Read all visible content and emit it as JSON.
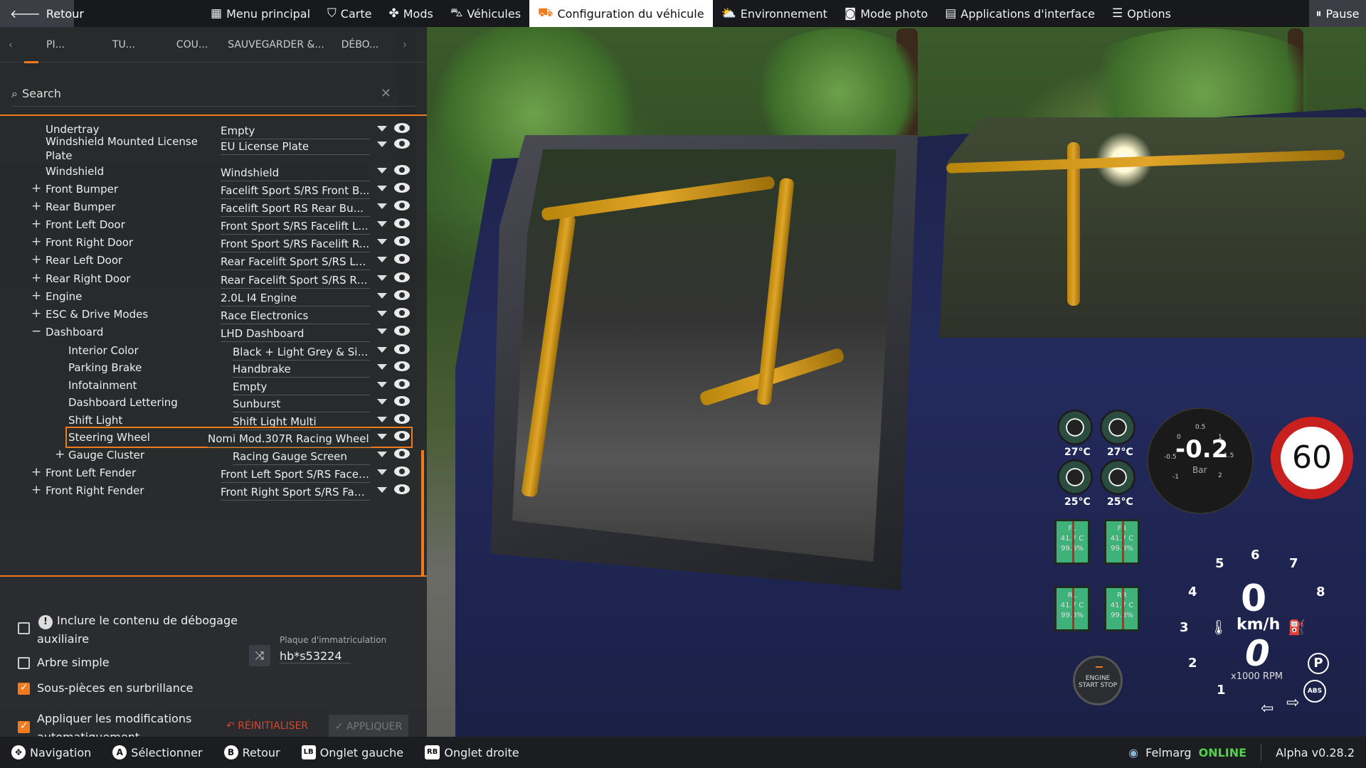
{
  "topbar": {
    "back_label": "Retour",
    "items": [
      {
        "label": "Menu principal",
        "icon": "grid-icon"
      },
      {
        "label": "Carte",
        "icon": "map-icon"
      },
      {
        "label": "Mods",
        "icon": "puzzle-icon"
      },
      {
        "label": "Véhicules",
        "icon": "car-icon"
      },
      {
        "label": "Configuration du véhicule",
        "icon": "car-config-icon",
        "active": true
      },
      {
        "label": "Environnement",
        "icon": "weather-icon"
      },
      {
        "label": "Mode photo",
        "icon": "camera-icon"
      },
      {
        "label": "Applications d'interface",
        "icon": "apps-icon"
      },
      {
        "label": "Options",
        "icon": "sliders-icon"
      }
    ],
    "pause_label": "Pause"
  },
  "tabs": [
    "PI...",
    "TU...",
    "COU...",
    "SAUVEGARDER &...",
    "DÉBO..."
  ],
  "search": {
    "placeholder": "Search"
  },
  "parts": [
    {
      "name": "Undertray",
      "value": "Empty",
      "expand": ""
    },
    {
      "name": "Windshield Mounted License Plate",
      "value": "EU License Plate",
      "expand": ""
    },
    {
      "name": "Windshield",
      "value": "Windshield",
      "expand": ""
    },
    {
      "name": "Front Bumper",
      "value": "Facelift Sport S/RS Front B...",
      "expand": "+"
    },
    {
      "name": "Rear Bumper",
      "value": "Facelift Sport RS Rear Bu...",
      "expand": "+"
    },
    {
      "name": "Front Left Door",
      "value": "Front Sport S/RS Facelift L...",
      "expand": "+"
    },
    {
      "name": "Front Right Door",
      "value": "Front Sport S/RS Facelift R...",
      "expand": "+"
    },
    {
      "name": "Rear Left Door",
      "value": "Rear Facelift Sport S/RS Le...",
      "expand": "+"
    },
    {
      "name": "Rear Right Door",
      "value": "Rear Facelift Sport S/RS Ri...",
      "expand": "+"
    },
    {
      "name": "Engine",
      "value": "2.0L I4 Engine",
      "expand": "+"
    },
    {
      "name": "ESC & Drive Modes",
      "value": "Race Electronics",
      "expand": "+"
    },
    {
      "name": "Dashboard",
      "value": "LHD Dashboard",
      "expand": "−"
    },
    {
      "name": "Interior Color",
      "value": "Black + Light Grey & Silver",
      "expand": ""
    },
    {
      "name": "Parking Brake",
      "value": "Handbrake",
      "expand": ""
    },
    {
      "name": "Infotainment",
      "value": "Empty",
      "expand": ""
    },
    {
      "name": "Dashboard Lettering",
      "value": "Sunburst",
      "expand": ""
    },
    {
      "name": "Shift Light",
      "value": "Shift Light Multi",
      "expand": ""
    },
    {
      "name": "Steering Wheel",
      "value": "Nomi Mod.307R Racing Wheel",
      "expand": "",
      "highlighted": true
    },
    {
      "name": "Gauge Cluster",
      "value": "Racing Gauge Screen",
      "expand": "+"
    },
    {
      "name": "Front Left Fender",
      "value": "Front Left Sport S/RS Facel...",
      "expand": "+"
    },
    {
      "name": "Front Right Fender",
      "value": "Front Right Sport S/RS Fac...",
      "expand": "+"
    }
  ],
  "options": {
    "debug_label": "Inclure le contenu de débogage auxiliaire",
    "simple_tree_label": "Arbre simple",
    "highlight_label": "Sous-pièces en surbrillance",
    "autoapply_label": "Appliquer les modifications automatiquement",
    "plate_label": "Plaque d'immatriculation",
    "plate_value": "hb*s53224",
    "reset_label": "RÉINITIALISER",
    "apply_label": "APPLIQUER"
  },
  "bottombar": {
    "items": [
      {
        "key": "✥",
        "label": "Navigation"
      },
      {
        "key": "A",
        "label": "Sélectionner"
      },
      {
        "key": "B",
        "label": "Retour"
      },
      {
        "key": "LB",
        "label": "Onglet gauche"
      },
      {
        "key": "RB",
        "label": "Onglet droite"
      }
    ],
    "user": "Felmarg",
    "status": "ONLINE",
    "version": "Alpha v0.28.2"
  },
  "hud": {
    "tire_temps": [
      "27°C",
      "27°C",
      "25°C",
      "25°C"
    ],
    "tire_minis": [
      {
        "pos": "FL",
        "temp": "41.7 C",
        "wear": "99.8%"
      },
      {
        "pos": "FR",
        "temp": "41.7 C",
        "wear": "99.8%"
      },
      {
        "pos": "RL",
        "temp": "41.7 C",
        "wear": "99.8%"
      },
      {
        "pos": "RR",
        "temp": "41.7 C",
        "wear": "99.8%"
      }
    ],
    "boost_value": "-0.2",
    "boost_unit": "Bar",
    "boost_ticks": [
      "0",
      "0.5",
      "1",
      "1.5",
      "2",
      "-0.5",
      "-1"
    ],
    "speed_limit": "60",
    "gear": "0",
    "speed_unit": "km/h",
    "speed": "0",
    "rpm_label": "x1000 RPM",
    "tach_numbers": [
      "1",
      "2",
      "3",
      "4",
      "5",
      "6",
      "7",
      "8"
    ],
    "startstop": "ENGINE START STOP"
  }
}
